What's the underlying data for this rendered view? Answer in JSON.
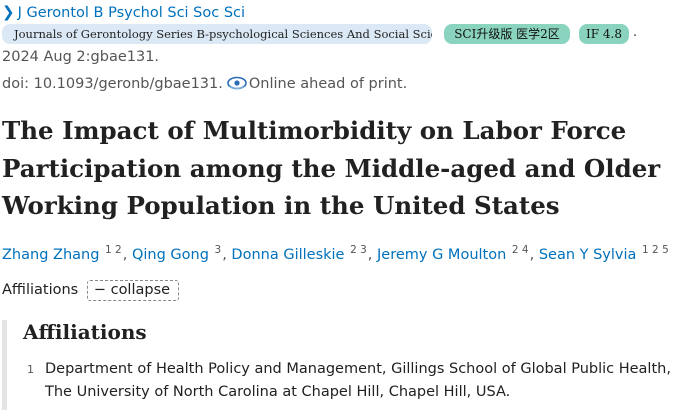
{
  "header": {
    "journal_abbrev": "J Gerontol B Psychol Sci Soc Sci",
    "journal_full": "Journals of Gerontology Series B-psychological Sciences And Social Sciences",
    "sci_badge": "SCI升级版 医学2区",
    "if_badge": "IF 4.8",
    "separator": ".",
    "date": "2024 Aug 2:gbae131.",
    "doi": "doi: 10.1093/geronb/gbae131.",
    "status": "Online ahead of print."
  },
  "article": {
    "title": "The Impact of Multimorbidity on Labor Force Participation among the Middle-aged and Older Working Population in the United States"
  },
  "authors": [
    {
      "name": "Zhang Zhang",
      "affs": "1 2"
    },
    {
      "name": "Qing Gong",
      "affs": "3"
    },
    {
      "name": "Donna Gilleskie",
      "affs": "2 3"
    },
    {
      "name": "Jeremy G Moulton",
      "affs": "2 4"
    },
    {
      "name": "Sean Y Sylvia",
      "affs": "1 2 5"
    }
  ],
  "affiliations": {
    "toggle_label": "Affiliations",
    "collapse_label": "collapse",
    "heading": "Affiliations",
    "items": [
      {
        "num": "1",
        "text": "Department of Health Policy and Management, Gillings School of Global Public Health, The University of North Carolina at Chapel Hill, Chapel Hill, USA."
      }
    ]
  },
  "icons": {
    "journal_chevron": "chevron-right-icon",
    "online_status": "eye-icon",
    "collapse": "minus-icon"
  },
  "colors": {
    "link": "#0071bc",
    "journal_tag_bg": "#dbe8f5",
    "metric_tag_bg": "#8ad3bf"
  }
}
